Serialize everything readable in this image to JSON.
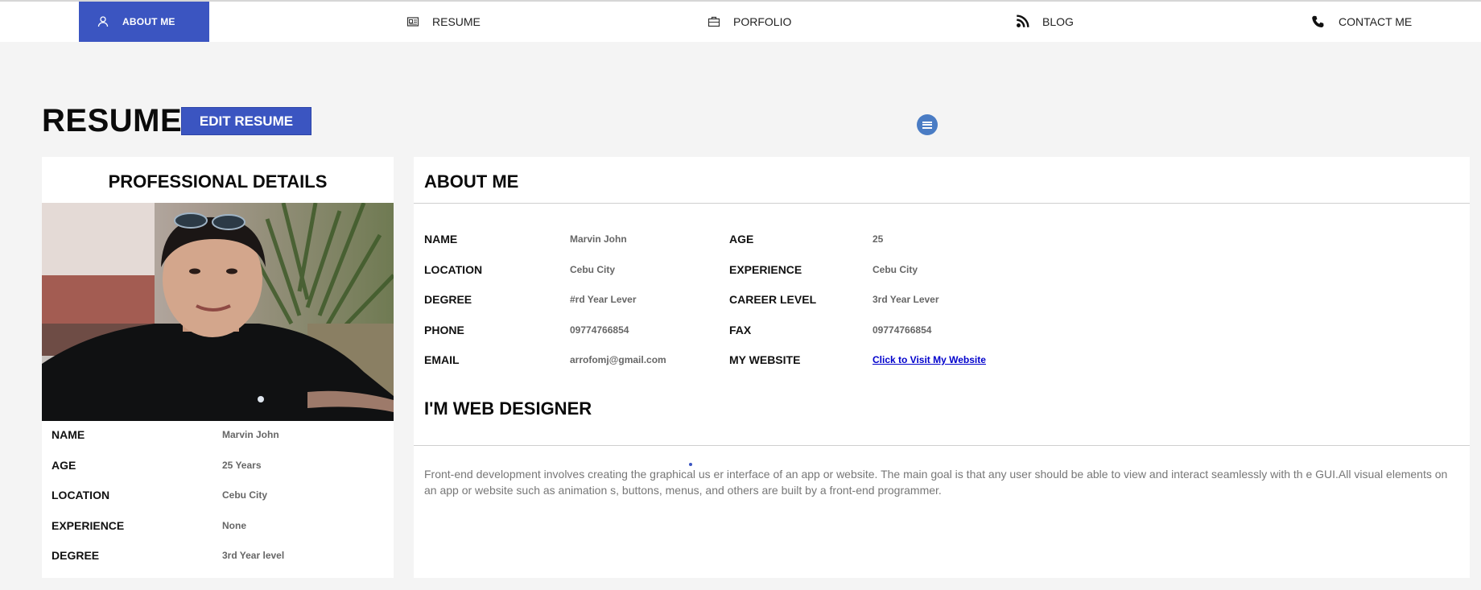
{
  "nav": {
    "items": [
      {
        "label": "ABOUT ME",
        "icon": "user-icon",
        "active": true
      },
      {
        "label": "RESUME",
        "icon": "resume-card-icon",
        "active": false
      },
      {
        "label": "PORFOLIO",
        "icon": "briefcase-icon",
        "active": false
      },
      {
        "label": "BLOG",
        "icon": "rss-icon",
        "active": false
      },
      {
        "label": "CONTACT ME",
        "icon": "phone-icon",
        "active": false
      }
    ],
    "active_color": "#3b55c1"
  },
  "header": {
    "title": "RESUME",
    "edit_button": "EDIT RESUME",
    "menu_icon": "hamburger-menu-icon"
  },
  "professional": {
    "title": "PROFESSIONAL DETAILS",
    "rows": [
      {
        "label": "NAME",
        "value": "Marvin John"
      },
      {
        "label": "AGE",
        "value": "25 Years"
      },
      {
        "label": "LOCATION",
        "value": "Cebu City"
      },
      {
        "label": "EXPERIENCE",
        "value": "None"
      },
      {
        "label": "DEGREE",
        "value": "3rd Year level"
      }
    ]
  },
  "about": {
    "title": "ABOUT ME",
    "left": [
      {
        "label": "NAME",
        "value": "Marvin John"
      },
      {
        "label": "LOCATION",
        "value": "Cebu City"
      },
      {
        "label": "DEGREE",
        "value": "#rd Year Lever"
      },
      {
        "label": "PHONE",
        "value": "09774766854"
      },
      {
        "label": "EMAIL",
        "value": "arrofomj@gmail.com"
      }
    ],
    "right": [
      {
        "label": "AGE",
        "value": "25"
      },
      {
        "label": "EXPERIENCE",
        "value": "Cebu City"
      },
      {
        "label": "CAREER LEVEL",
        "value": "3rd Year Lever"
      },
      {
        "label": "FAX",
        "value": "09774766854"
      },
      {
        "label": "MY WEBSITE",
        "value": "Click to Visit My Website"
      }
    ],
    "subtitle": "I'M WEB DESIGNER",
    "description": "Front-end development involves creating the graphical us er interface of an app or website. The main goal is that any user should be able to view and interact seamlessly with th e GUI.All visual elements on an app or website such as animation s, buttons, menus, and others are built by a front-end programmer."
  }
}
